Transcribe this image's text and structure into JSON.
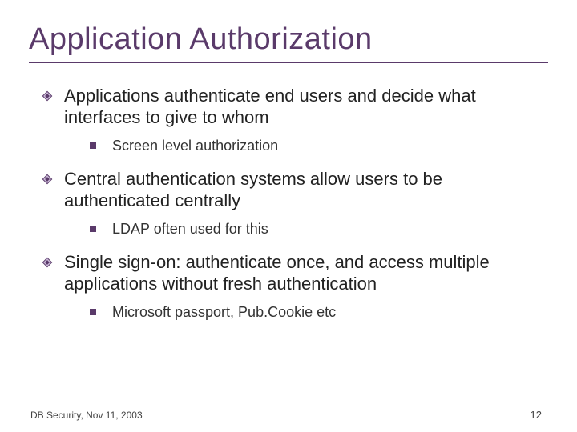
{
  "title": "Application Authorization",
  "bullets": [
    {
      "text": "Applications authenticate end users and decide what interfaces to give to whom",
      "sub": [
        "Screen level authorization"
      ]
    },
    {
      "text": "Central authentication systems allow users to be authenticated centrally",
      "sub": [
        "LDAP often used for this"
      ]
    },
    {
      "text": "Single sign-on: authenticate once, and access multiple applications without fresh authentication",
      "sub": [
        "Microsoft passport, Pub.Cookie etc"
      ]
    }
  ],
  "footer": "DB Security, Nov 11, 2003",
  "page_number": "12",
  "colors": {
    "accent": "#5a3a6a"
  }
}
